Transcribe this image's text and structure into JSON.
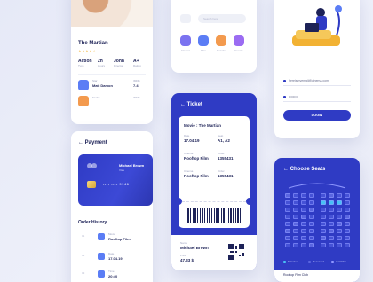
{
  "movie": {
    "title": "The Martian",
    "stars": "★★★★☆",
    "stats": [
      {
        "value": "Action",
        "label": "Type"
      },
      {
        "value": "2h",
        "label": "Hours"
      },
      {
        "value": "John",
        "label": "Director"
      },
      {
        "value": "A+",
        "label": "Rating"
      }
    ],
    "rows": [
      {
        "label": "Star",
        "name": "Matt Damon",
        "tag": "IMDB",
        "score": "7.4",
        "color": "#5b7df5"
      },
      {
        "label": "Studio",
        "name": "",
        "tag": "IMDB",
        "score": "",
        "color": "#f39a4e"
      }
    ]
  },
  "apps": {
    "search_placeholder": "Search here",
    "icons": [
      {
        "label": "Cinema",
        "color": "#7b73f0"
      },
      {
        "label": "Film",
        "color": "#5b7df5"
      },
      {
        "label": "Snacks",
        "color": "#f39a4e"
      },
      {
        "label": "Events",
        "color": "#9b6cf2"
      }
    ]
  },
  "login": {
    "email": "hereismyemail@cinema.com",
    "password": "••••••••",
    "button": "LOGIN"
  },
  "payment": {
    "title": "Payment",
    "back_icon": "arrow-left-icon",
    "card_name": "Michael Brown",
    "card_sub": "Visa",
    "card_number": "•••• •••• 9146",
    "order_history_title": "Order History",
    "orders": [
      {
        "num": "01",
        "label": "Movie",
        "value": "Rooftop Film",
        "color": "#5b7df5"
      },
      {
        "num": "02",
        "label": "Date",
        "value": "17.04.19",
        "color": "#5b7df5"
      },
      {
        "num": "03",
        "label": "Time",
        "value": "20:40",
        "color": "#5b7df5"
      }
    ]
  },
  "ticket": {
    "title": "Ticket",
    "movie": "Movie : The Martian",
    "fields": [
      {
        "label": "Date",
        "value": "17.04.19"
      },
      {
        "label": "Seat",
        "value": "A1, A2"
      },
      {
        "label": "Cinema",
        "value": "Rooftop Film"
      },
      {
        "label": "Order",
        "value": "1355431"
      },
      {
        "label": "Cinema",
        "value": "Rooftop Film"
      },
      {
        "label": "Order",
        "value": "1355431"
      }
    ],
    "name_label": "Name",
    "name": "Michael Brown",
    "price_label": "Price",
    "price": "47.33 $"
  },
  "seats": {
    "title": "Choose Seats",
    "legend": [
      "Selected",
      "Reserved",
      "Available"
    ],
    "footer": "Rooftop Film Club",
    "colors": {
      "available": "#4552d6",
      "reserved": "#5a66e0",
      "selected": "#48c0f5"
    }
  },
  "colors": {
    "accent": "#2f3bc4",
    "dark": "#1d2257"
  }
}
